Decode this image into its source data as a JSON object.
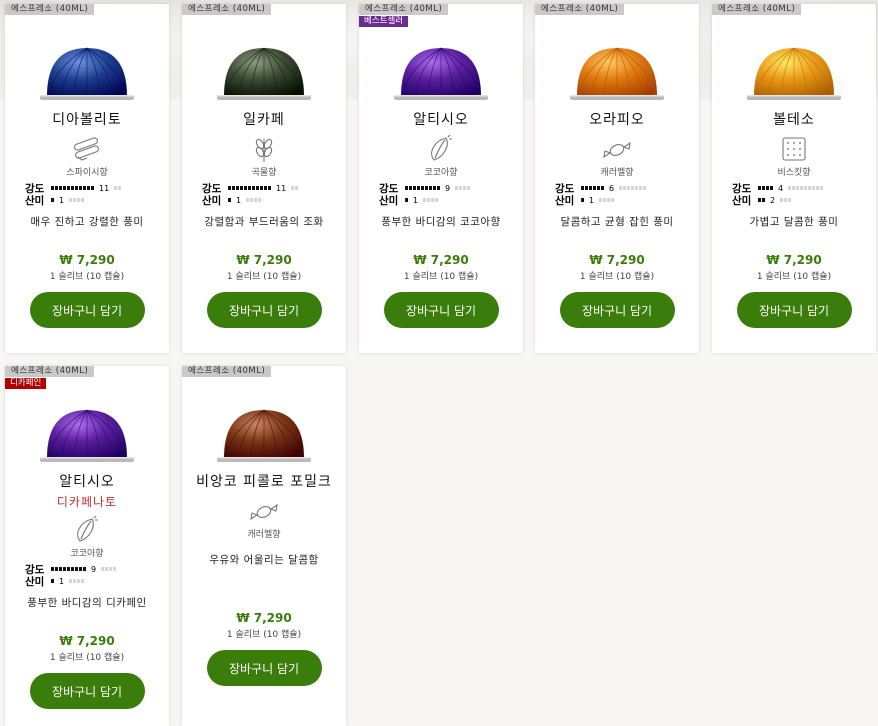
{
  "products": [
    {
      "size_tag": "에스프레소 (40ML)",
      "badge": "",
      "name": "디아볼리토",
      "decaf_label": "",
      "aroma": "스파이시향",
      "aroma_icon": "spice-icon",
      "intensity_label": "강도",
      "intensity": 11,
      "intensity_max": 13,
      "acidity_label": "산미",
      "acidity": 1,
      "acidity_max": 5,
      "description": "매우 진하고 강렬한 풍미",
      "price": "₩ 7,290",
      "unit": "1 슬리브 (10 캡슐)",
      "cta": "장바구니 담기",
      "capsule_color": "#1f3f8f"
    },
    {
      "size_tag": "에스프레소 (40ML)",
      "badge": "",
      "name": "일카페",
      "decaf_label": "",
      "aroma": "곡물향",
      "aroma_icon": "grain-icon",
      "intensity_label": "강도",
      "intensity": 11,
      "intensity_max": 13,
      "acidity_label": "산미",
      "acidity": 1,
      "acidity_max": 5,
      "description": "강렬함과 부드러움의 조화",
      "price": "₩ 7,290",
      "unit": "1 슬리브 (10 캡슐)",
      "cta": "장바구니 담기",
      "capsule_color": "#3d4a34"
    },
    {
      "size_tag": "에스프레소 (40ML)",
      "badge": "베스트셀러",
      "badge_color": "purple",
      "name": "알티시오",
      "decaf_label": "",
      "aroma": "코코아향",
      "aroma_icon": "cocoa-icon",
      "intensity_label": "강도",
      "intensity": 9,
      "intensity_max": 13,
      "acidity_label": "산미",
      "acidity": 1,
      "acidity_max": 5,
      "description": "풍부한 바디감의 코코아향",
      "price": "₩ 7,290",
      "unit": "1 슬리브 (10 캡슐)",
      "cta": "장바구니 담기",
      "capsule_color": "#5b1f9e"
    },
    {
      "size_tag": "에스프레소 (40ML)",
      "badge": "",
      "name": "오라피오",
      "decaf_label": "",
      "aroma": "캐러멜향",
      "aroma_icon": "caramel-icon",
      "intensity_label": "강도",
      "intensity": 6,
      "intensity_max": 13,
      "acidity_label": "산미",
      "acidity": 1,
      "acidity_max": 5,
      "description": "달콤하고 균형 잡힌 풍미",
      "price": "₩ 7,290",
      "unit": "1 슬리브 (10 캡슐)",
      "cta": "장바구니 담기",
      "capsule_color": "#e07a10"
    },
    {
      "size_tag": "에스프레소 (40ML)",
      "badge": "",
      "name": "볼테소",
      "decaf_label": "",
      "aroma": "비스킷향",
      "aroma_icon": "biscuit-icon",
      "intensity_label": "강도",
      "intensity": 4,
      "intensity_max": 13,
      "acidity_label": "산미",
      "acidity": 2,
      "acidity_max": 5,
      "description": "가볍고 달콤한 풍미",
      "price": "₩ 7,290",
      "unit": "1 슬리브 (10 캡슐)",
      "cta": "장바구니 담기",
      "capsule_color": "#e89a18"
    },
    {
      "size_tag": "에스프레소 (40ML)",
      "badge": "디카페인",
      "badge_color": "red",
      "name": "알티시오",
      "decaf_label": "디카페나토",
      "aroma": "코코아향",
      "aroma_icon": "cocoa-icon",
      "intensity_label": "강도",
      "intensity": 9,
      "intensity_max": 13,
      "acidity_label": "산미",
      "acidity": 1,
      "acidity_max": 5,
      "description": "풍부한 바디감의 디카페인",
      "price": "₩ 7,290",
      "unit": "1 슬리브 (10 캡슐)",
      "cta": "장바구니 담기",
      "capsule_color": "#5b1f9e"
    },
    {
      "size_tag": "에스프레소 (40ML)",
      "badge": "",
      "name": "비앙코 피콜로 포밀크",
      "decaf_label": "",
      "aroma": "캐러멜향",
      "aroma_icon": "caramel-icon",
      "intensity_label": "",
      "intensity": null,
      "acidity_label": "",
      "acidity": null,
      "description": "우유와 어울리는 달콤함",
      "price": "₩ 7,290",
      "unit": "1 슬리브 (10 캡슐)",
      "cta": "장바구니 담기",
      "capsule_color": "#7a3516"
    }
  ]
}
